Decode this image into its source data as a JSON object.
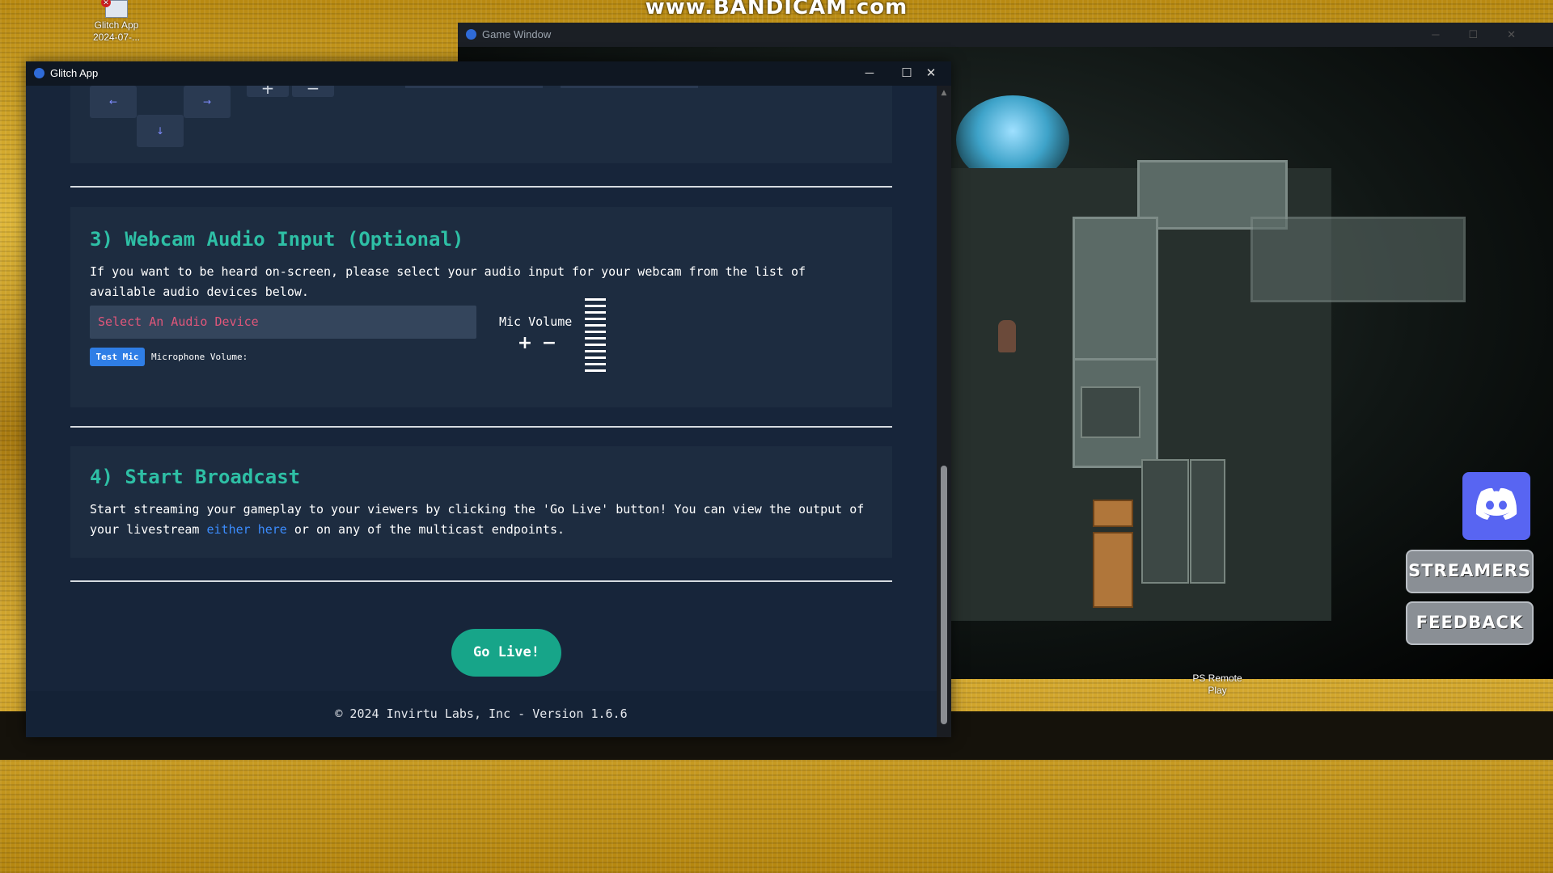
{
  "desktop": {
    "watermark": "www.BANDICAM.com",
    "icon_glitch_line1": "Glitch App",
    "icon_glitch_line2": "2024-07-...",
    "icon_ps_line1": "PS Remote",
    "icon_ps_line2": "Play"
  },
  "game_window": {
    "title": "Game Window",
    "streamers_label": "STREAMERS",
    "feedback_label": "FEEDBACK"
  },
  "app_window": {
    "title": "Glitch App",
    "controls": {
      "minimize": "─",
      "maximize": "☐",
      "close": "✕"
    }
  },
  "keybinds": {
    "left": "←",
    "right": "→",
    "down": "↓",
    "plus": "+",
    "minus": "−"
  },
  "webcam_audio": {
    "heading": "3) Webcam Audio Input (Optional)",
    "description": "If you want to be heard on-screen, please select your audio input for your webcam from the list of available audio devices below.",
    "select_placeholder": "Select An Audio Device",
    "test_mic_label": "Test Mic",
    "mic_volume_caption": "Microphone Volume:",
    "mic_volume_label": "Mic Volume",
    "plus_label": "+",
    "minus_label": "−"
  },
  "broadcast": {
    "heading": "4) Start Broadcast",
    "text_before_link": "Start streaming your gameplay to your viewers by clicking the 'Go Live' button! You can view the output of your livestream ",
    "link_text": "either here",
    "text_after_link": " or on any of the multicast endpoints.",
    "go_live_label": "Go Live!"
  },
  "footer": {
    "text": "© 2024 Invirtu Labs, Inc - Version 1.6.6"
  },
  "colors": {
    "accent_heading": "#2ebfa5",
    "go_live": "#17a589",
    "test_mic": "#2f7ee6",
    "link": "#3c8dff",
    "placeholder": "#e0567a",
    "discord": "#5865f2"
  }
}
